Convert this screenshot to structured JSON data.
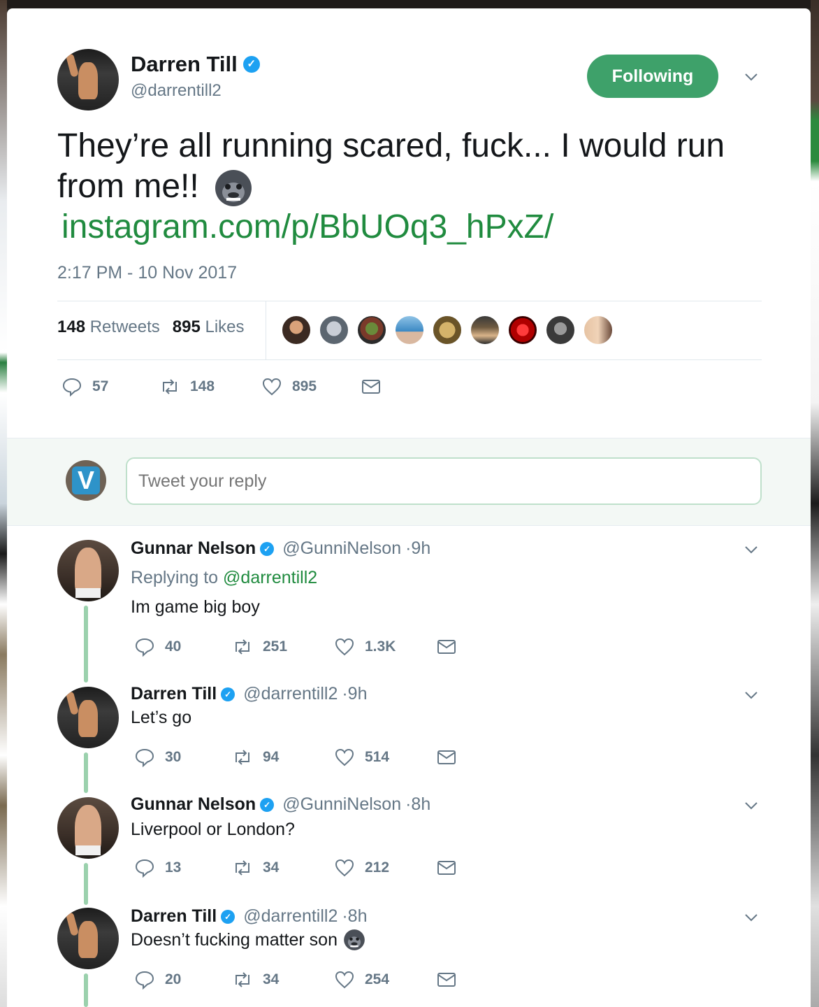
{
  "tweet": {
    "author_name": "Darren Till",
    "author_handle": "@darrentill2",
    "follow_label": "Following",
    "text": "They’re all running scared, fuck... I would run from me!!",
    "link": "instagram.com/p/BbUOq3_hPxZ/",
    "timestamp": "2:17 PM - 10 Nov 2017",
    "retweets_count": "148",
    "retweets_label": "Retweets",
    "likes_count": "895",
    "likes_label": "Likes",
    "actions": {
      "replies": "57",
      "retweets": "148",
      "likes": "895"
    }
  },
  "compose": {
    "placeholder": "Tweet your reply"
  },
  "replies": [
    {
      "name": "Gunnar Nelson",
      "handle": "@GunniNelson",
      "time": "·9h",
      "replying_label": "Replying to",
      "replying_to": "@darrentill2",
      "text": "Im game big boy",
      "replies": "40",
      "retweets": "251",
      "likes": "1.3K"
    },
    {
      "name": "Darren Till",
      "handle": "@darrentill2",
      "time": "·9h",
      "text": "Let’s go",
      "replies": "30",
      "retweets": "94",
      "likes": "514"
    },
    {
      "name": "Gunnar Nelson",
      "handle": "@GunniNelson",
      "time": "·8h",
      "text": "Liverpool or London?",
      "replies": "13",
      "retweets": "34",
      "likes": "212"
    },
    {
      "name": "Darren Till",
      "handle": "@darrentill2",
      "time": "·8h",
      "text": "Doesn’t fucking matter son",
      "replies": "20",
      "retweets": "34",
      "likes": "254"
    }
  ],
  "colors": {
    "accent_green": "#3ea16a",
    "link_green": "#208b3f",
    "verified_blue": "#1da1f2",
    "muted": "#657786"
  }
}
